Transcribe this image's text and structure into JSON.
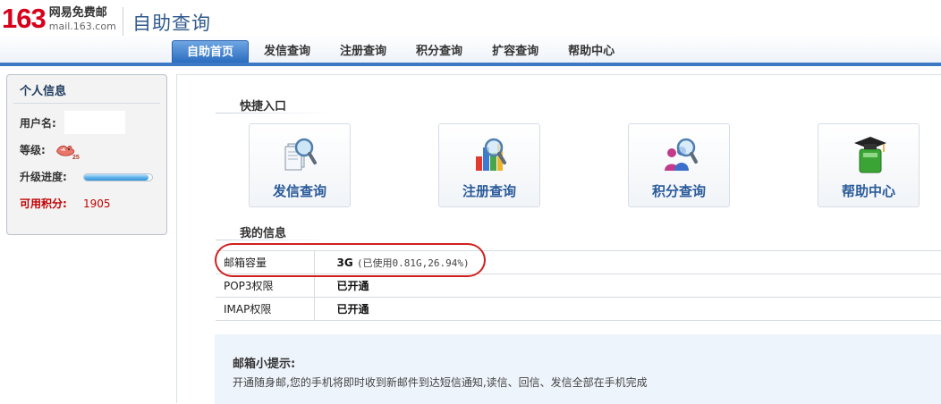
{
  "header": {
    "logo_number": "163",
    "logo_cn": "网易免费邮",
    "logo_url": "mail.163.com",
    "page_title": "自助查询"
  },
  "nav": {
    "items": [
      "自助首页",
      "发信查询",
      "注册查询",
      "积分查询",
      "扩容查询",
      "帮助中心"
    ],
    "active": "自助首页"
  },
  "sidebar": {
    "title": "个人信息",
    "username_label": "用户名:",
    "level_label": "等级:",
    "level_badge": "25",
    "progress_label": "升级进度:",
    "progress_fraction": 0.95,
    "points_label": "可用积分:",
    "points_value": "1905"
  },
  "quick": {
    "title": "快捷入口",
    "items": [
      {
        "label": "发信查询",
        "icon": "send-query-icon"
      },
      {
        "label": "注册查询",
        "icon": "register-query-icon"
      },
      {
        "label": "积分查询",
        "icon": "points-query-icon"
      },
      {
        "label": "帮助中心",
        "icon": "help-center-icon"
      }
    ]
  },
  "myinfo": {
    "title": "我的信息",
    "rows": [
      {
        "key": "邮箱容量",
        "value": "3G",
        "extra": "(已使用0.81G,26.94%)"
      },
      {
        "key": "POP3权限",
        "value": "已开通"
      },
      {
        "key": "IMAP权限",
        "value": "已开通"
      }
    ]
  },
  "tip": {
    "title": "邮箱小提示:",
    "text": "开通随身邮,您的手机将即时收到新邮件到达短信通知,读信、回信、发信全部在手机完成"
  },
  "colors": {
    "brand_red": "#d8001b",
    "nav_active": "#2b6cc0",
    "link_blue": "#2b5b9a",
    "highlight_red": "#d0201f"
  }
}
